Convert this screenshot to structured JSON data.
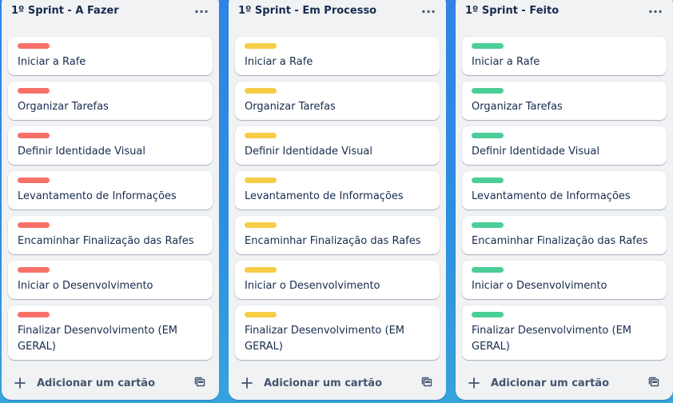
{
  "lists": [
    {
      "title": "1º Sprint - A Fazer",
      "menu_glyph": "···",
      "label_color": "#f87168",
      "cards": [
        {
          "title": "Iniciar a Rafe"
        },
        {
          "title": "Organizar Tarefas"
        },
        {
          "title": "Definir Identidade Visual"
        },
        {
          "title": "Levantamento de Informações"
        },
        {
          "title": "Encaminhar Finalização das Rafes"
        },
        {
          "title": "Iniciar o Desenvolvimento"
        },
        {
          "title": "Finalizar Desenvolvimento (EM GERAL)"
        }
      ],
      "add_card_label": "Adicionar um cartão"
    },
    {
      "title": "1º Sprint - Em Processo",
      "menu_glyph": "···",
      "label_color": "#f5cd47",
      "cards": [
        {
          "title": "Iniciar a Rafe"
        },
        {
          "title": "Organizar Tarefas"
        },
        {
          "title": "Definir Identidade Visual"
        },
        {
          "title": "Levantamento de Informações"
        },
        {
          "title": "Encaminhar Finalização das Rafes"
        },
        {
          "title": "Iniciar o Desenvolvimento"
        },
        {
          "title": "Finalizar Desenvolvimento (EM GERAL)"
        }
      ],
      "add_card_label": "Adicionar um cartão"
    },
    {
      "title": "1º Sprint - Feito",
      "menu_glyph": "···",
      "label_color": "#4bce97",
      "cards": [
        {
          "title": "Iniciar a Rafe"
        },
        {
          "title": "Organizar Tarefas"
        },
        {
          "title": "Definir Identidade Visual"
        },
        {
          "title": "Levantamento de Informações"
        },
        {
          "title": "Encaminhar Finalização das Rafes"
        },
        {
          "title": "Iniciar o Desenvolvimento"
        },
        {
          "title": "Finalizar Desenvolvimento (EM GERAL)"
        }
      ],
      "add_card_label": "Adicionar um cartão"
    }
  ],
  "icons": {
    "add": "plus-icon",
    "template": "card-template-icon",
    "menu": "more-horizontal-icon"
  }
}
